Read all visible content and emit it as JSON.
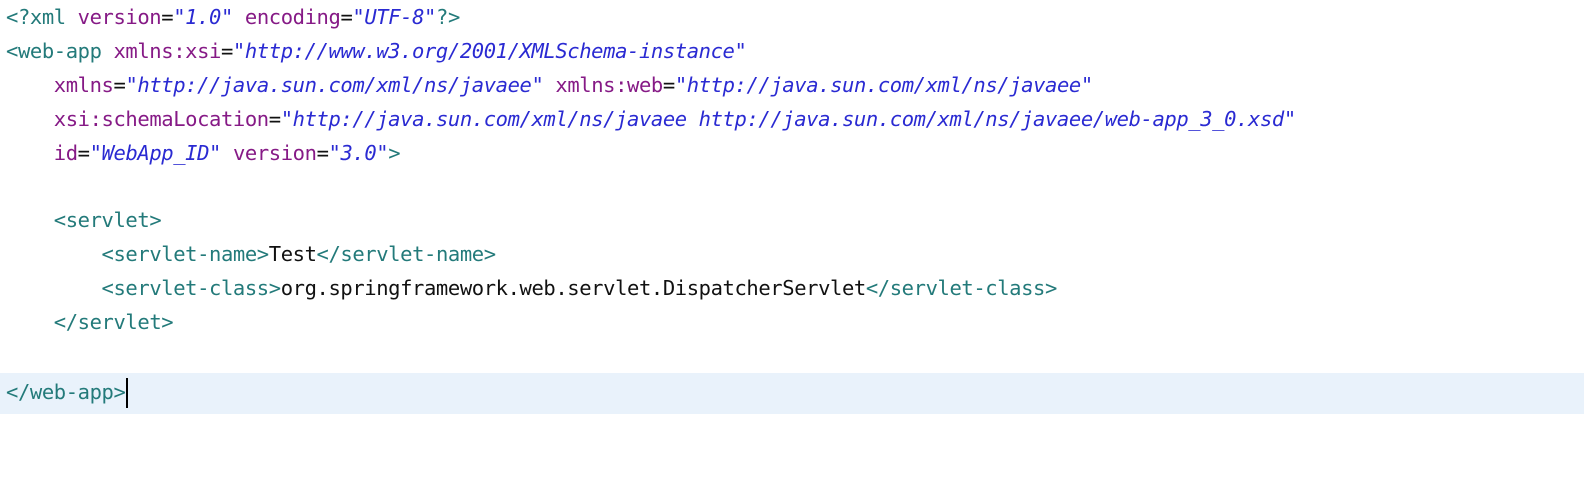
{
  "editor": {
    "current_line_bg": "#e9f2fb",
    "colors": {
      "tag": "#237a7a",
      "attribute": "#861a86",
      "string": "#2a2ad2",
      "text": "#111111"
    },
    "lines": {
      "l1": {
        "p1": "<?xml ",
        "p2": "version",
        "p3": "=",
        "p4": "\"1.0\"",
        "p5": " ",
        "p6": "encoding",
        "p7": "=",
        "p8": "\"UTF-8\"",
        "p9": "?>"
      },
      "l2": {
        "p1": "<web-app ",
        "p2": "xmlns:xsi",
        "p3": "=",
        "p4": "\"http://www.w3.org/2001/XMLSchema-instance\""
      },
      "l3": {
        "indent": "    ",
        "p1": "xmlns",
        "p2": "=",
        "p3": "\"http://java.sun.com/xml/ns/javaee\"",
        "p4": " ",
        "p5": "xmlns:web",
        "p6": "=",
        "p7": "\"http://java.sun.com/xml/ns/javaee\""
      },
      "l4": {
        "indent": "    ",
        "p1": "xsi:schemaLocation",
        "p2": "=",
        "p3": "\"http://java.sun.com/xml/ns/javaee http://java.sun.com/xml/ns/javaee/web-app_3_0.xsd\""
      },
      "l5": {
        "indent": "    ",
        "p1": "id",
        "p2": "=",
        "p3": "\"WebApp_ID\"",
        "p4": " ",
        "p5": "version",
        "p6": "=",
        "p7": "\"3.0\"",
        "p8": ">"
      },
      "l7": {
        "indent": "    ",
        "p1": "<servlet>"
      },
      "l8": {
        "indent": "        ",
        "p1": "<servlet-name>",
        "p2": "Test",
        "p3": "</servlet-name>"
      },
      "l9": {
        "indent": "        ",
        "p1": "<servlet-class>",
        "p2": "org.springframework.web.servlet.DispatcherServlet",
        "p3": "</servlet-class>"
      },
      "l10": {
        "indent": "    ",
        "p1": "</servlet>"
      },
      "l12": {
        "p1": "</web-app>"
      }
    }
  }
}
